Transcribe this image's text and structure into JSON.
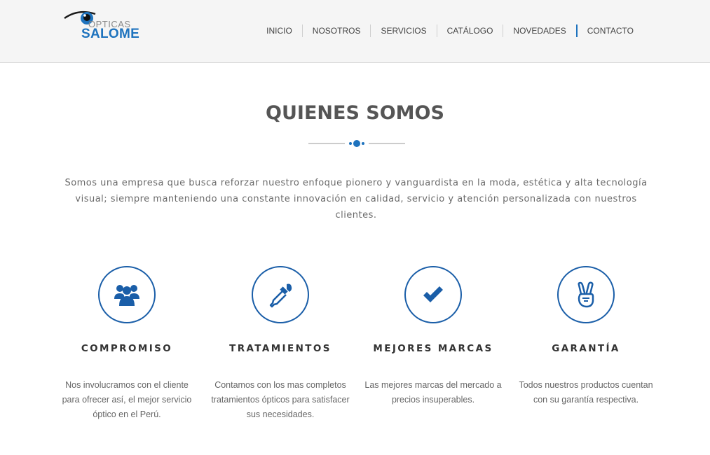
{
  "brand": {
    "logo_top": "OPTICAS",
    "logo_bottom": "SALOME",
    "accent": "#1e73be"
  },
  "nav": {
    "items": [
      "INICIO",
      "NOSOTROS",
      "SERVICIOS",
      "CATÁLOGO",
      "NOVEDADES",
      "CONTACTO"
    ]
  },
  "section": {
    "title": "QUIENES SOMOS",
    "intro": "Somos una empresa que busca reforzar nuestro enfoque pionero y vanguardista en la moda, estética y alta tecnología visual; siempre manteniendo una constante innovación en calidad, servicio y atención personalizada con nuestros clientes."
  },
  "features": [
    {
      "icon": "users-icon",
      "title": "COMPROMISO",
      "text": "Nos involucramos con el cliente para ofrecer así, el mejor servicio óptico en el Perú."
    },
    {
      "icon": "eyedropper-icon",
      "title": "TRATAMIENTOS",
      "text": "Contamos con los mas completos tratamientos ópticos para satisfacer sus necesidades."
    },
    {
      "icon": "checkmark-icon",
      "title": "MEJORES MARCAS",
      "text": "Las mejores marcas del mercado a precios insuperables."
    },
    {
      "icon": "peace-hand-icon",
      "title": "GARANTÍA",
      "text": "Todos nuestros productos cuentan con su garantía respectiva."
    }
  ]
}
